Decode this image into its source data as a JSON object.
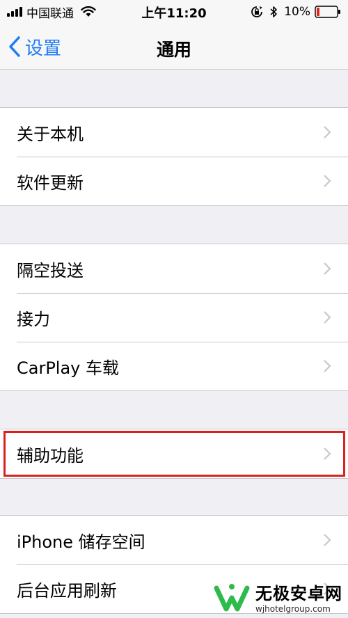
{
  "status_bar": {
    "carrier": "中国联通",
    "time": "上午11:20",
    "battery": "10%"
  },
  "nav": {
    "back_label": "设置",
    "title": "通用"
  },
  "groups": [
    {
      "items": [
        {
          "label": "关于本机"
        },
        {
          "label": "软件更新"
        }
      ]
    },
    {
      "items": [
        {
          "label": "隔空投送"
        },
        {
          "label": "接力"
        },
        {
          "label": "CarPlay 车载"
        }
      ]
    },
    {
      "items": [
        {
          "label": "辅助功能",
          "highlighted": true
        }
      ]
    },
    {
      "items": [
        {
          "label": "iPhone 储存空间"
        },
        {
          "label": "后台应用刷新"
        }
      ]
    }
  ],
  "colors": {
    "accent": "#1d7bf6",
    "highlight": "#d9221c",
    "background": "#efeff4",
    "battery_low": "#e0251b",
    "watermark_green": "#2dbb4c"
  },
  "watermark": {
    "title": "无极安卓网",
    "url": "wjhotelgroup.com"
  },
  "icons": {
    "signal": "cellular-signal-icon",
    "wifi": "wifi-icon",
    "rotation_lock": "rotation-lock-icon",
    "bluetooth": "bluetooth-icon",
    "battery": "battery-icon",
    "back": "chevron-left-icon",
    "disclosure": "chevron-right-icon"
  }
}
